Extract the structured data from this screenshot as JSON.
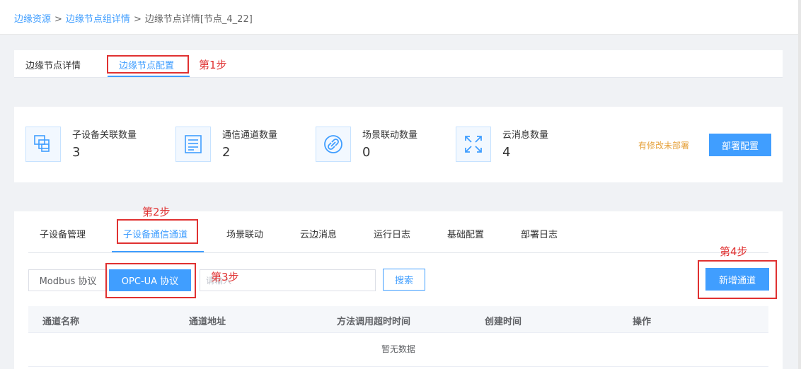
{
  "breadcrumb": {
    "item1": "边缘资源",
    "item2": "边缘节点组详情",
    "item3": "边缘节点详情[节点_4_22]",
    "separator": ">"
  },
  "top_tabs": {
    "tab1": "边缘节点详情",
    "tab2": "边缘节点配置"
  },
  "annotations": {
    "step1": "第1步",
    "step2": "第2步",
    "step3": "第3步",
    "step4": "第4步"
  },
  "stats": [
    {
      "label": "子设备关联数量",
      "value": "3",
      "icon": "devices-icon"
    },
    {
      "label": "通信通道数量",
      "value": "2",
      "icon": "list-icon"
    },
    {
      "label": "场景联动数量",
      "value": "0",
      "icon": "link-icon"
    },
    {
      "label": "云消息数量",
      "value": "4",
      "icon": "arrows-icon"
    }
  ],
  "pending_text": "有修改未部署",
  "deploy_label": "部署配置",
  "sub_tabs": [
    "子设备管理",
    "子设备通信通道",
    "场景联动",
    "云边消息",
    "运行日志",
    "基础配置",
    "部署日志"
  ],
  "protocol": {
    "modbus": "Modbus 协议",
    "opc": "OPC-UA 协议"
  },
  "search": {
    "placeholder": "请输入",
    "value": "",
    "button": "搜索"
  },
  "add_channel_label": "新增通道",
  "table": {
    "columns": [
      "通道名称",
      "通道地址",
      "方法调用超时时间",
      "创建时间",
      "操作"
    ],
    "empty_text": "暂无数据"
  },
  "colors": {
    "primary": "#409eff",
    "annotation": "#e03131",
    "warning": "#e6a23c"
  }
}
